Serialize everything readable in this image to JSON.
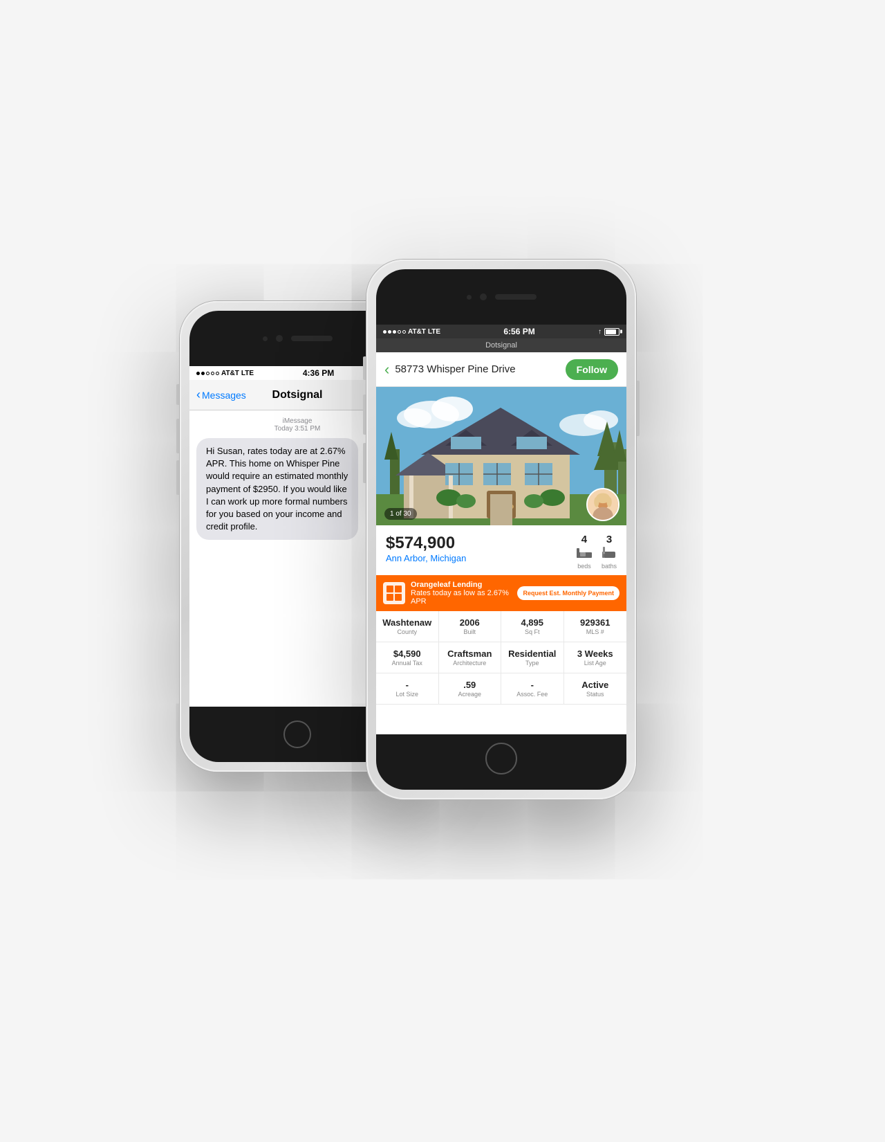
{
  "scene": {
    "background": "#f5f5f5"
  },
  "phone_messages": {
    "status_bar": {
      "carrier": "AT&T",
      "network": "LTE",
      "time": "4:36 PM",
      "signal_dots": [
        true,
        true,
        false,
        false,
        false
      ]
    },
    "nav": {
      "back_label": "Messages",
      "title": "Dotsignal"
    },
    "message_meta": {
      "type": "iMessage",
      "time": "Today 3:51 PM"
    },
    "message_body": "Hi Susan, rates today are at 2.67% APR. This home on Whisper Pine would require an estimated monthly payment of $2950. If you would like I can work up more formal numbers for you based on your income and credit profile."
  },
  "phone_property": {
    "status_bar": {
      "carrier": "AT&T",
      "network": "LTE",
      "time": "6:56 PM",
      "signal_dots": [
        true,
        true,
        true,
        false,
        false
      ]
    },
    "nav": {
      "title": "Dotsignal"
    },
    "address_bar": {
      "address": "58773 Whisper Pine Drive",
      "follow_label": "Follow"
    },
    "property_image": {
      "counter": "1 of 30"
    },
    "price": {
      "value": "$574,900",
      "location": "Ann Arbor, Michigan"
    },
    "beds": "4",
    "baths": "3",
    "beds_label": "beds",
    "baths_label": "baths",
    "lending": {
      "name": "Orangeleaf Lending",
      "rate_text": "Rates today as low as 2.67% APR",
      "cta": "Request Est. Monthly Payment"
    },
    "details": [
      [
        {
          "value": "Washtenaw",
          "label": "County"
        },
        {
          "value": "2006",
          "label": "Built"
        },
        {
          "value": "4,895",
          "label": "Sq Ft"
        },
        {
          "value": "929361",
          "label": "MLS #"
        }
      ],
      [
        {
          "value": "$4,590",
          "label": "Annual Tax"
        },
        {
          "value": "Craftsman",
          "label": "Architecture"
        },
        {
          "value": "Residential",
          "label": "Type"
        },
        {
          "value": "3 Weeks",
          "label": "List Age"
        }
      ],
      [
        {
          "value": "-",
          "label": "Lot Size"
        },
        {
          "value": ".59",
          "label": "Acreage"
        },
        {
          "value": "-",
          "label": "Assoc. Fee"
        },
        {
          "value": "Active",
          "label": "Status"
        }
      ]
    ]
  }
}
